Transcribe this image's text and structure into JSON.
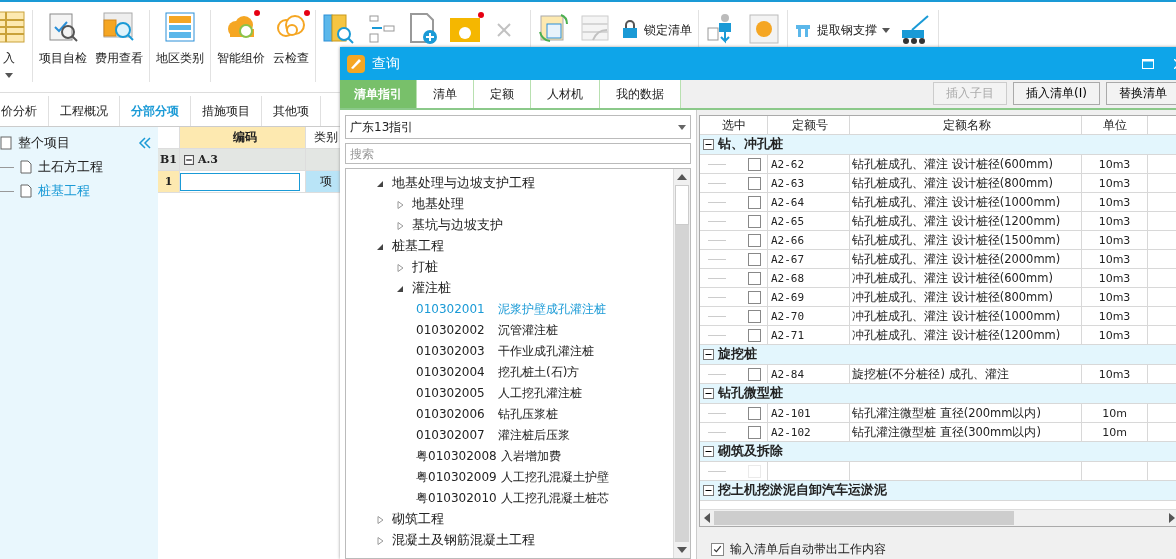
{
  "ribbon": {
    "groups": [
      {
        "items": [
          {
            "kind": "large",
            "label": "入",
            "dropdown": true
          }
        ]
      },
      {
        "items": [
          {
            "kind": "large",
            "label": "项目自检"
          },
          {
            "kind": "large",
            "label": "费用查看"
          }
        ]
      },
      {
        "items": [
          {
            "kind": "large",
            "label": "地区类别"
          }
        ]
      },
      {
        "items": [
          {
            "kind": "large",
            "label": "智能组价",
            "dot": true
          },
          {
            "kind": "large",
            "label": "云检查",
            "dot": true
          }
        ]
      },
      {
        "items": [
          {
            "kind": "icon"
          },
          {
            "kind": "icon"
          },
          {
            "kind": "icon"
          },
          {
            "kind": "icon",
            "dot": true
          },
          {
            "kind": "icon",
            "disabled": true
          }
        ]
      },
      {
        "items": [
          {
            "kind": "icon"
          },
          {
            "kind": "icon",
            "disabled": true
          },
          {
            "kind": "small",
            "label": "锁定清单"
          }
        ]
      },
      {
        "items": [
          {
            "kind": "icon"
          },
          {
            "kind": "icon"
          }
        ]
      },
      {
        "items": [
          {
            "kind": "small",
            "label": "提取钢支撑",
            "dropdown": true
          },
          {
            "kind": "icon"
          }
        ]
      }
    ]
  },
  "main_tabs": [
    {
      "label": "价分析",
      "selected": false
    },
    {
      "label": "工程概况",
      "selected": false
    },
    {
      "label": "分部分项",
      "selected": true
    },
    {
      "label": "措施项目",
      "selected": false
    },
    {
      "label": "其他项",
      "selected": false
    }
  ],
  "project_tree": {
    "root": "整个项目",
    "children": [
      {
        "label": "土石方工程",
        "selected": false
      },
      {
        "label": "桩基工程",
        "selected": true
      }
    ]
  },
  "grid": {
    "columns": [
      "编码",
      "类别"
    ],
    "rows": [
      {
        "kind": "section",
        "index": "B1",
        "code": "A.3",
        "expanded": true
      },
      {
        "kind": "item",
        "index": "1",
        "type": "项"
      }
    ]
  },
  "dialog": {
    "title": "查询",
    "tabs": [
      {
        "label": "清单指引",
        "selected": true
      },
      {
        "label": "清单",
        "selected": false
      },
      {
        "label": "定额",
        "selected": false
      },
      {
        "label": "人材机",
        "selected": false
      },
      {
        "label": "我的数据",
        "selected": false
      }
    ],
    "buttons": [
      {
        "label": "插入子目",
        "disabled": true
      },
      {
        "label": "插入清单(I)",
        "disabled": false
      },
      {
        "label": "替换清单",
        "disabled": false
      }
    ],
    "guide_select": "广东13指引",
    "search": {
      "placeholder": "搜索"
    },
    "tree": [
      {
        "label": "地基处理与边坡支护工程",
        "expanded": true,
        "children": [
          {
            "label": "地基处理",
            "expanded": false
          },
          {
            "label": "基坑与边坡支护",
            "expanded": false
          }
        ]
      },
      {
        "label": "桩基工程",
        "expanded": true,
        "children": [
          {
            "label": "打桩",
            "expanded": false
          },
          {
            "label": "灌注桩",
            "expanded": true,
            "children": [
              {
                "code": "010302001",
                "label": "泥浆护壁成孔灌注桩",
                "selected": true
              },
              {
                "code": "010302002",
                "label": "沉管灌注桩",
                "selected": false
              },
              {
                "code": "010302003",
                "label": "干作业成孔灌注桩",
                "selected": false
              },
              {
                "code": "010302004",
                "label": "挖孔桩土(石)方",
                "selected": false
              },
              {
                "code": "010302005",
                "label": "人工挖孔灌注桩",
                "selected": false
              },
              {
                "code": "010302006",
                "label": "钻孔压浆桩",
                "selected": false
              },
              {
                "code": "010302007",
                "label": "灌注桩后压浆",
                "selected": false
              },
              {
                "code": "粤010302008",
                "label": "入岩增加费",
                "selected": false
              },
              {
                "code": "粤010302009",
                "label": "人工挖孔混凝土护壁",
                "selected": false
              },
              {
                "code": "粤010302010",
                "label": "人工挖孔混凝土桩芯",
                "selected": false
              }
            ]
          }
        ]
      },
      {
        "label": "砌筑工程",
        "expanded": false
      },
      {
        "label": "混凝土及钢筋混凝土工程",
        "expanded": false
      }
    ],
    "table": {
      "columns": [
        "选中",
        "定额号",
        "定额名称",
        "单位"
      ],
      "groups": [
        {
          "title": "钻、冲孔桩",
          "expanded": true,
          "rows": [
            {
              "code": "A2-62",
              "name": "钻孔桩成孔、灌注 设计桩径(600mm)",
              "unit": "10m3",
              "checked": false
            },
            {
              "code": "A2-63",
              "name": "钻孔桩成孔、灌注 设计桩径(800mm)",
              "unit": "10m3",
              "checked": false
            },
            {
              "code": "A2-64",
              "name": "钻孔桩成孔、灌注 设计桩径(1000mm)",
              "unit": "10m3",
              "checked": false
            },
            {
              "code": "A2-65",
              "name": "钻孔桩成孔、灌注 设计桩径(1200mm)",
              "unit": "10m3",
              "checked": false
            },
            {
              "code": "A2-66",
              "name": "钻孔桩成孔、灌注 设计桩径(1500mm)",
              "unit": "10m3",
              "checked": false
            },
            {
              "code": "A2-67",
              "name": "钻孔桩成孔、灌注 设计桩径(2000mm)",
              "unit": "10m3",
              "checked": false
            },
            {
              "code": "A2-68",
              "name": "冲孔桩成孔、灌注 设计桩径(600mm)",
              "unit": "10m3",
              "checked": false
            },
            {
              "code": "A2-69",
              "name": "冲孔桩成孔、灌注 设计桩径(800mm)",
              "unit": "10m3",
              "checked": false
            },
            {
              "code": "A2-70",
              "name": "冲孔桩成孔、灌注 设计桩径(1000mm)",
              "unit": "10m3",
              "checked": false
            },
            {
              "code": "A2-71",
              "name": "冲孔桩成孔、灌注 设计桩径(1200mm)",
              "unit": "10m3",
              "checked": false
            }
          ]
        },
        {
          "title": "旋挖桩",
          "expanded": true,
          "rows": [
            {
              "code": "A2-84",
              "name": "旋挖桩(不分桩径) 成孔、灌注",
              "unit": "10m3",
              "checked": false
            }
          ]
        },
        {
          "title": "钻孔微型桩",
          "expanded": true,
          "rows": [
            {
              "code": "A2-101",
              "name": "钻孔灌注微型桩 直径(200mm以内)",
              "unit": "10m",
              "checked": false
            },
            {
              "code": "A2-102",
              "name": "钻孔灌注微型桩 直径(300mm以内)",
              "unit": "10m",
              "checked": false
            }
          ]
        },
        {
          "title": "砌筑及拆除",
          "expanded": true,
          "rows": [
            {
              "checked": false,
              "disabled": true
            }
          ]
        },
        {
          "title": "挖土机挖淤泥自卸汽车运淤泥",
          "expanded": true
        }
      ]
    },
    "auto_work_content": {
      "label": "输入清单后自动带出工作内容",
      "checked": true
    }
  }
}
